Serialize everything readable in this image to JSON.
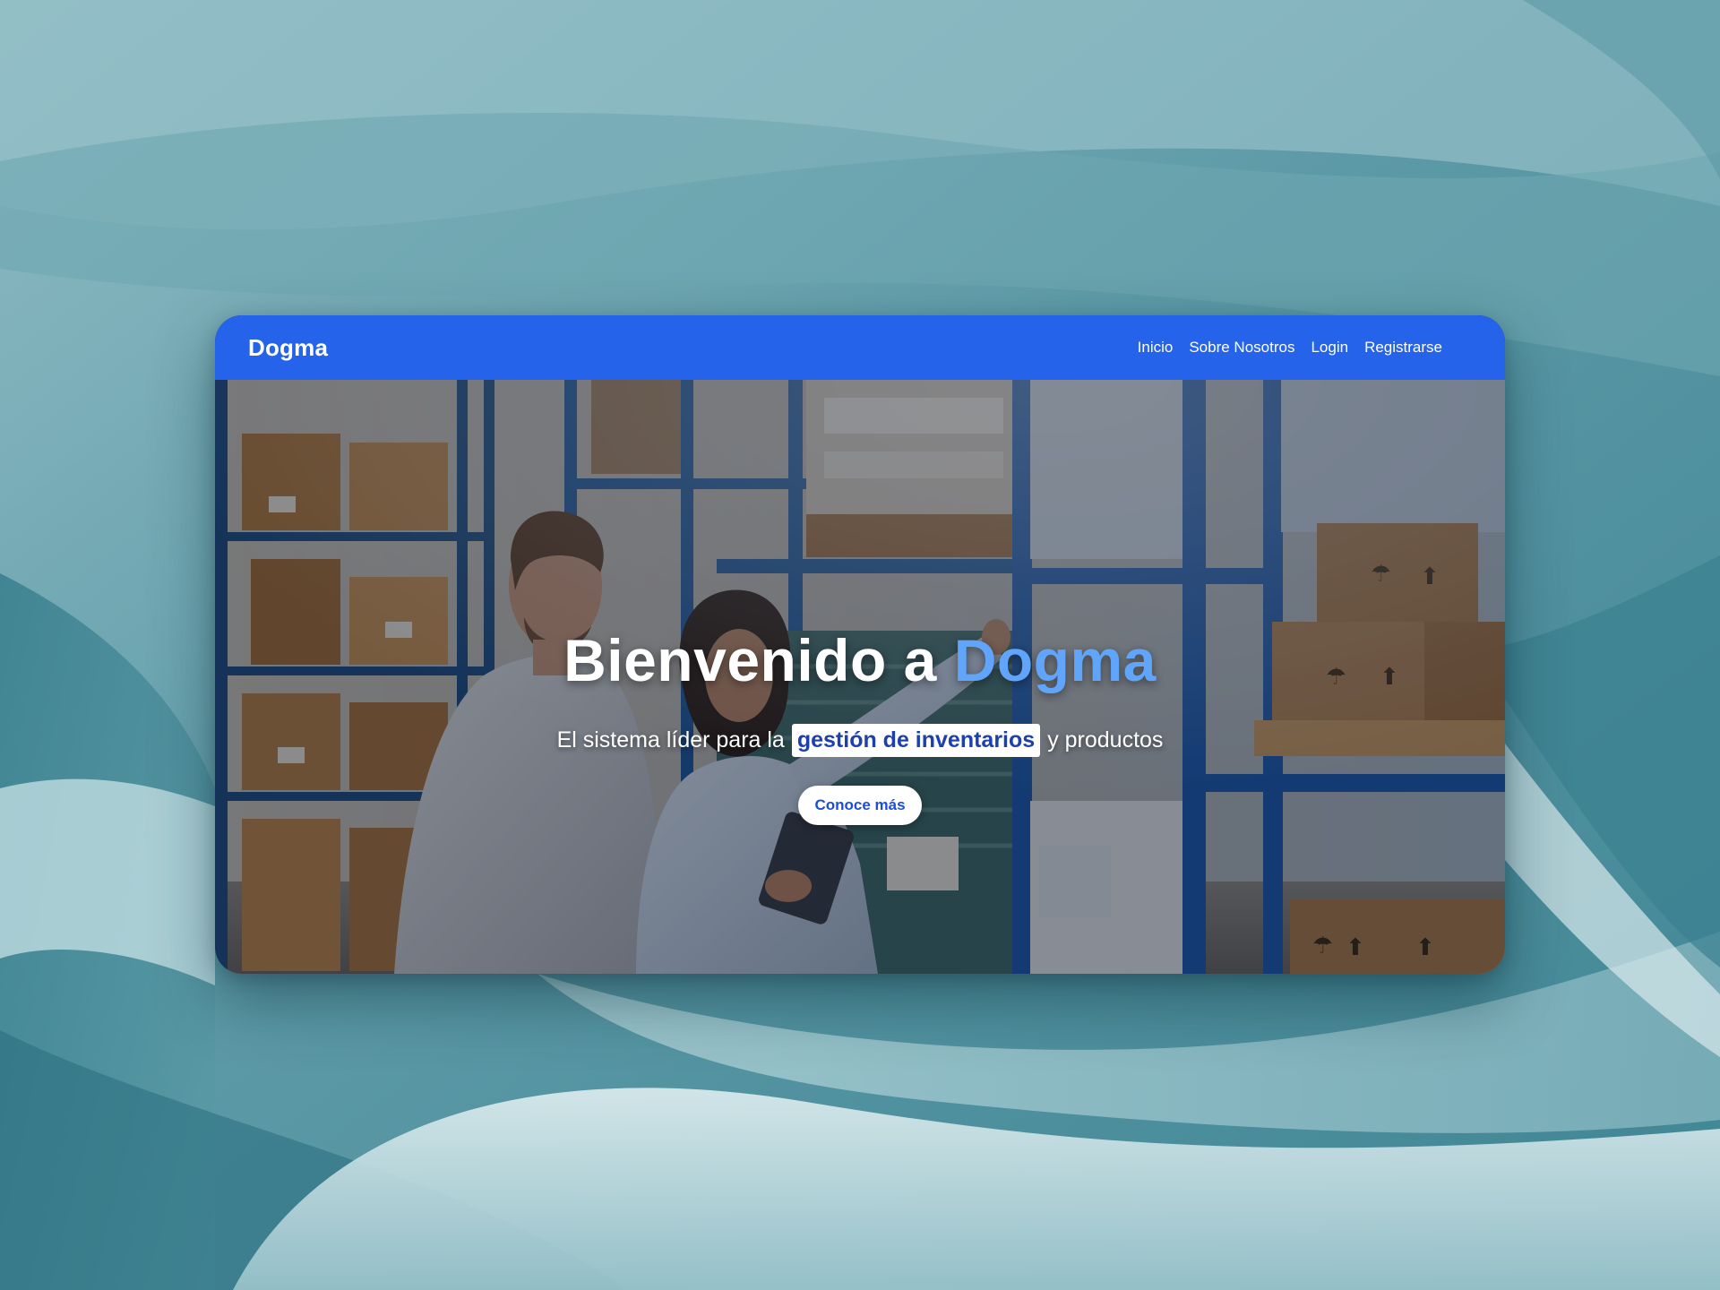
{
  "navbar": {
    "brand": "Dogma",
    "links": [
      {
        "label": "Inicio"
      },
      {
        "label": "Sobre Nosotros"
      },
      {
        "label": "Login"
      },
      {
        "label": "Registrarse"
      }
    ],
    "background_color": "#2563eb"
  },
  "hero": {
    "title_prefix": "Bienvenido a",
    "title_brand": "Dogma",
    "subtitle_before": "El sistema líder para la",
    "subtitle_highlight": "gestión de inventarios",
    "subtitle_after": "y productos",
    "cta_label": "Conoce más",
    "accent_color": "#60a5fa",
    "highlight_text_color": "#1e40af",
    "background_image": "warehouse-photo"
  }
}
